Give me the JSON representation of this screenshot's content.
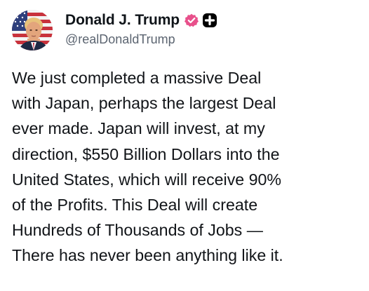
{
  "author": {
    "display_name": "Donald J. Trump",
    "handle": "@realDonaldTrump",
    "avatar_icon": "profile-photo-flag-portrait",
    "verified_icon": "verified-badge-icon",
    "verified_color": "#e8508b",
    "extra_badge_icon": "plus-badge-icon"
  },
  "post": {
    "lines": [
      "We just completed a massive Deal",
      "with Japan, perhaps the largest Deal",
      "ever made. Japan will invest, at my",
      "direction, $550 Billion Dollars into the",
      "United States, which will receive 90%",
      "of the Profits. This Deal will create",
      "Hundreds of Thousands of Jobs —",
      "There has never been anything like it."
    ]
  }
}
